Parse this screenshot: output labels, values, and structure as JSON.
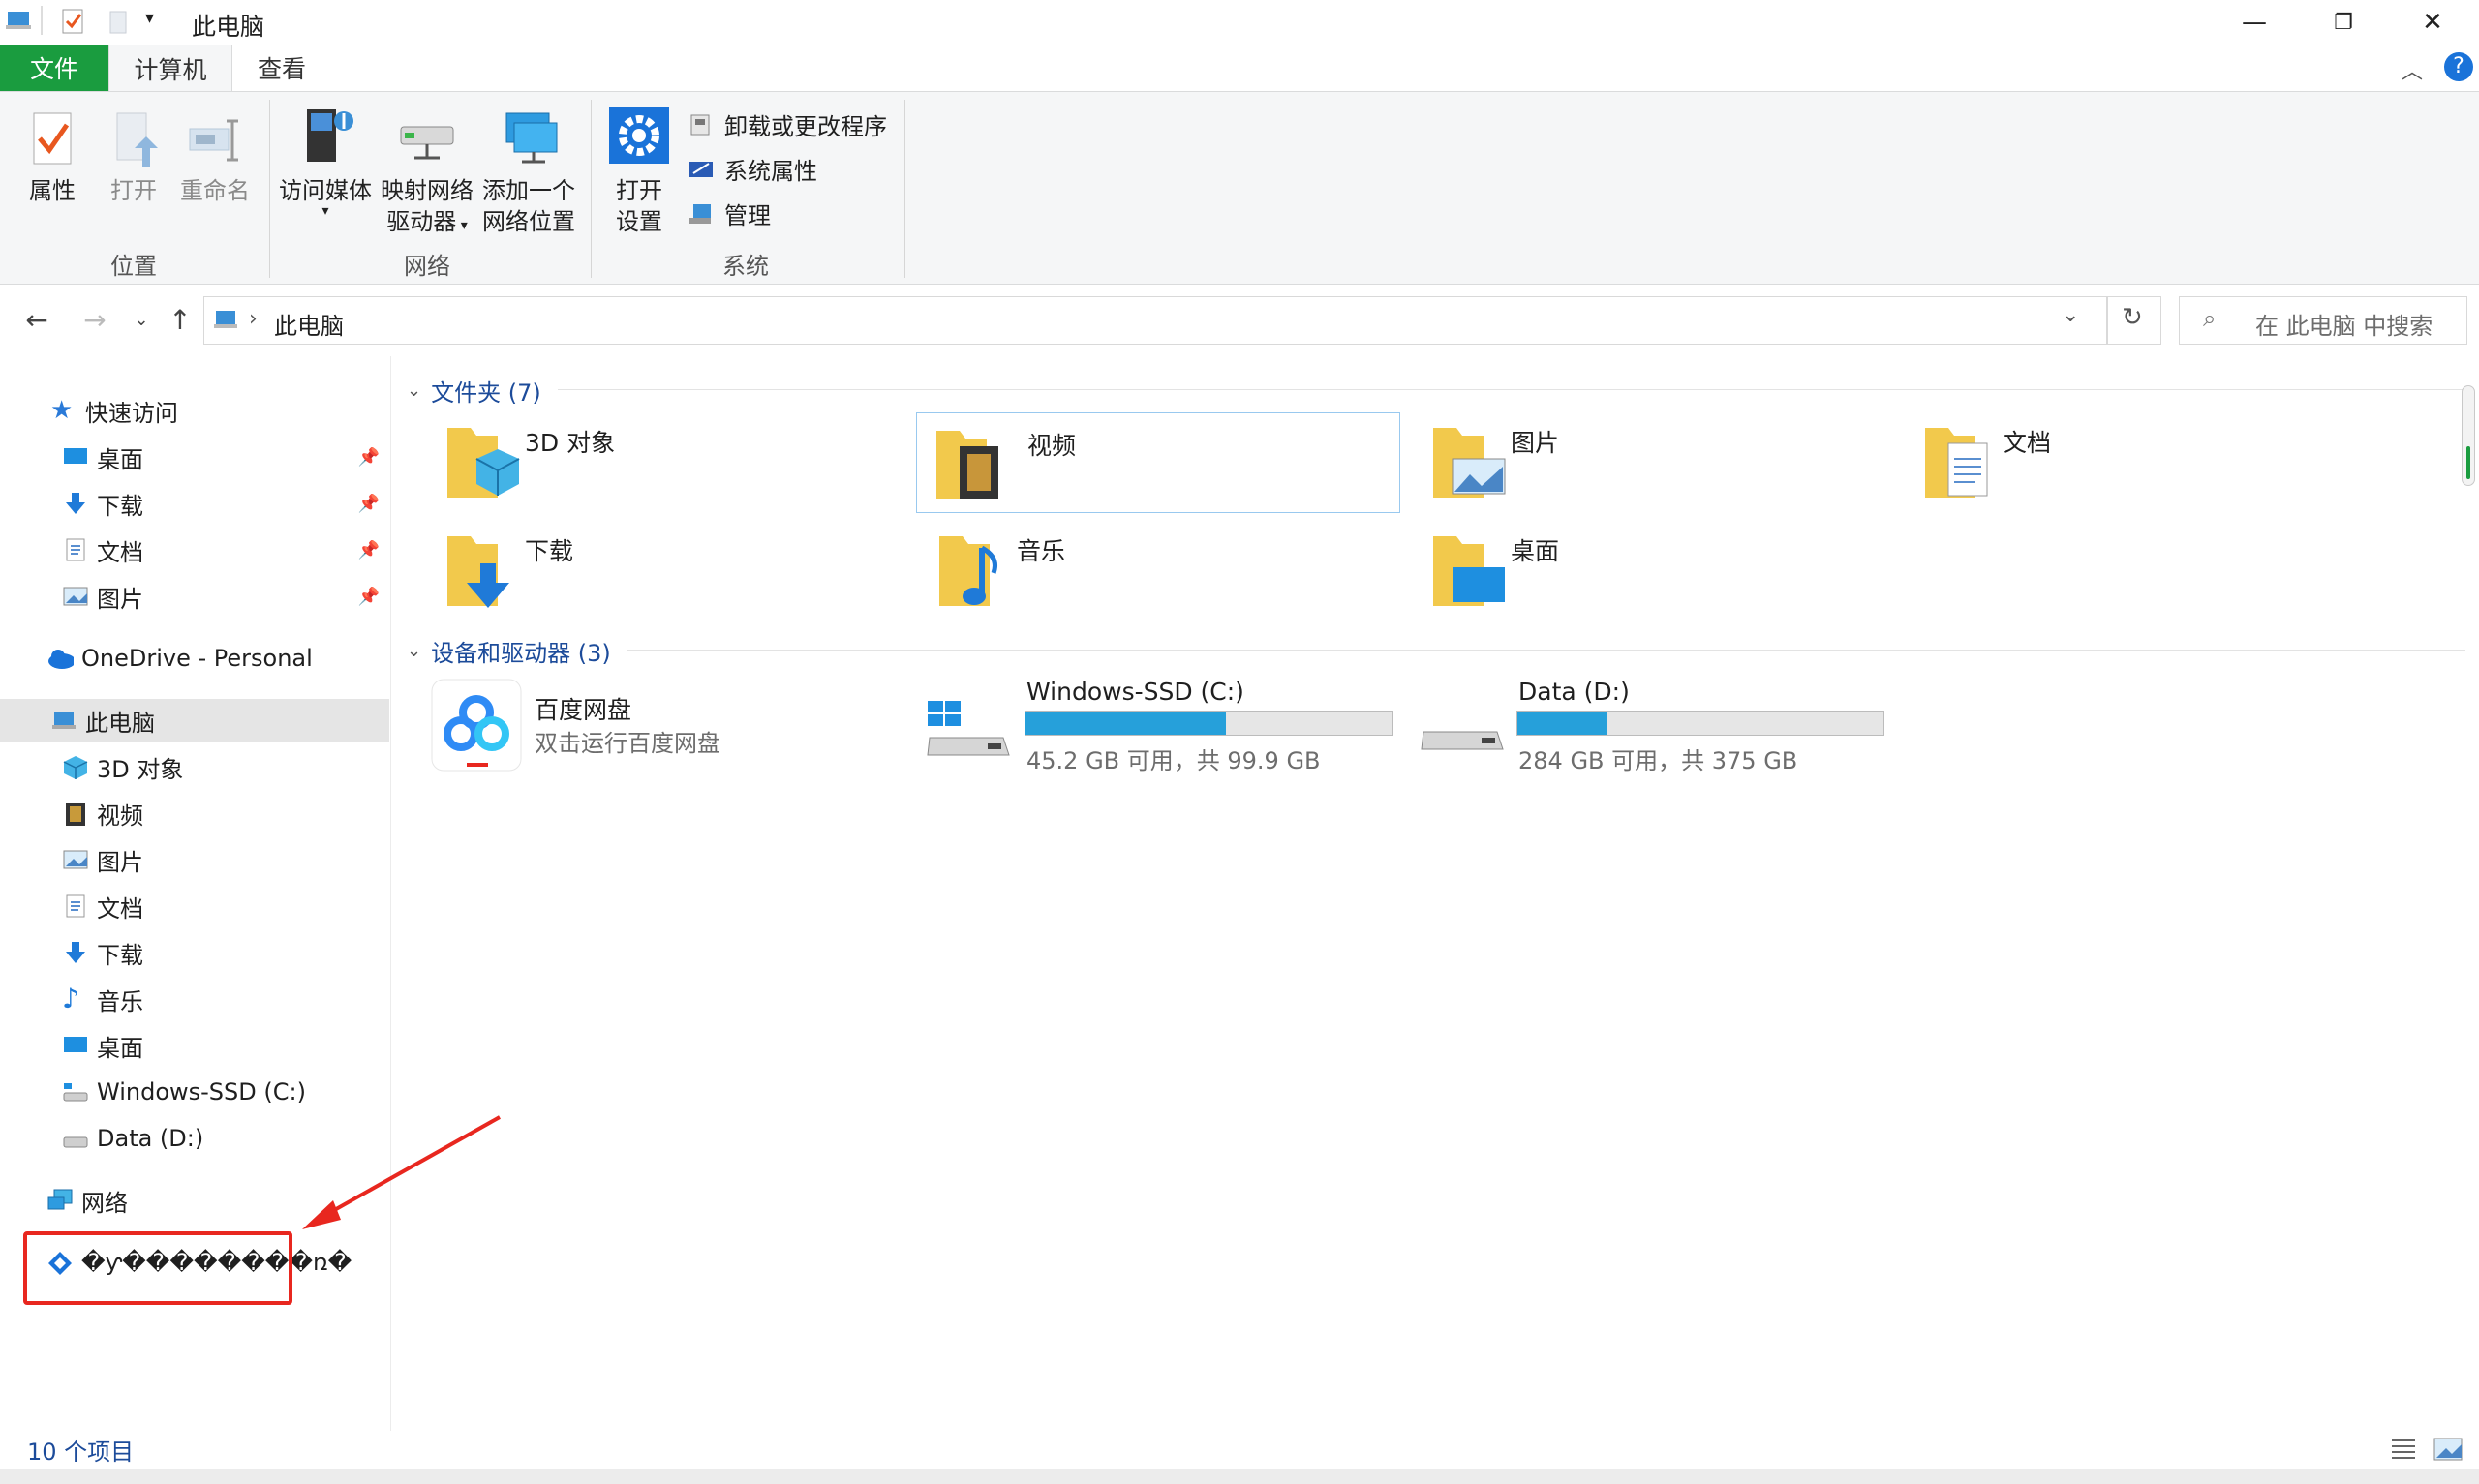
{
  "window": {
    "title": "此电脑",
    "minimize_icon": "minimize-icon",
    "maximize_icon": "restore-icon",
    "close_icon": "close-icon"
  },
  "tabs": [
    "文件",
    "计算机",
    "查看"
  ],
  "ribbon": {
    "location": {
      "label": "位置",
      "properties": "属性",
      "open": "打开",
      "rename": "重命名"
    },
    "network": {
      "label": "网络",
      "access_media": "访问媒体",
      "map_drive_1": "映射网络",
      "map_drive_2": "驱动器",
      "add_location_1": "添加一个",
      "add_location_2": "网络位置"
    },
    "system": {
      "label": "系统",
      "open_settings_1": "打开",
      "open_settings_2": "设置",
      "uninstall": "卸载或更改程序",
      "sys_props": "系统属性",
      "manage": "管理"
    }
  },
  "address": {
    "path": "此电脑",
    "search_placeholder": "在 此电脑 中搜索"
  },
  "sidebar": {
    "quick_access": "快速访问",
    "quick_items": [
      "桌面",
      "下载",
      "文档",
      "图片"
    ],
    "onedrive": "OneDrive - Personal",
    "this_pc": "此电脑",
    "pc_items": [
      "3D 对象",
      "视频",
      "图片",
      "文档",
      "下载",
      "音乐",
      "桌面",
      "Windows-SSD (C:)",
      "Data (D:)"
    ],
    "network": "网络",
    "garbled": "�ƴ��������ռ�"
  },
  "main": {
    "folders_header": "文件夹 (7)",
    "folders": [
      "3D 对象",
      "视频",
      "图片",
      "文档",
      "下载",
      "音乐",
      "桌面"
    ],
    "devices_header": "设备和驱动器 (3)",
    "baidu": {
      "name": "百度网盘",
      "sub": "双击运行百度网盘"
    },
    "drive_c": {
      "name": "Windows-SSD (C:)",
      "sub": "45.2 GB 可用，共 99.9 GB",
      "used_fraction": 0.548
    },
    "drive_d": {
      "name": "Data (D:)",
      "sub": "284 GB 可用，共 375 GB",
      "used_fraction": 0.243
    }
  },
  "status": {
    "count": "10 个项目"
  },
  "colors": {
    "accent": "#1a9c3f",
    "link": "#1c4b9a",
    "bar_fill": "#26a0da",
    "highlight": "#e8271f"
  }
}
